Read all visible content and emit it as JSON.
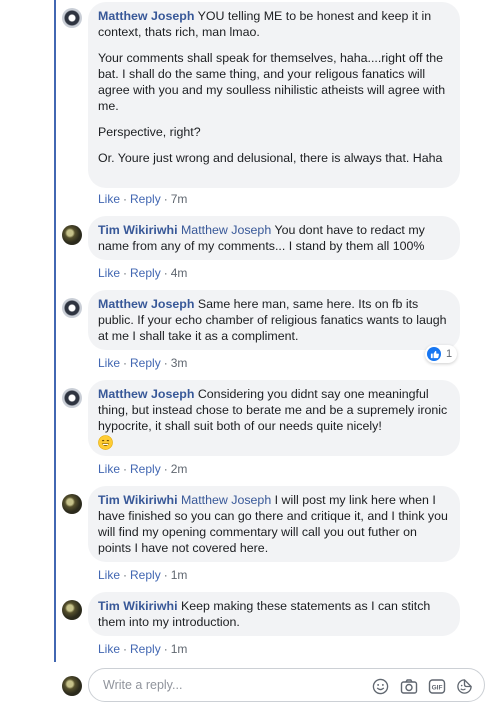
{
  "comments": [
    {
      "author": "Matthew Joseph",
      "mention": "",
      "paragraphs": [
        "YOU telling ME to be honest and keep it in context, thats rich, man lmao.",
        "Your comments shall speak for themselves, haha....right off the bat. I shall do the same thing, and your religous fanatics will agree with you and my soulless nihilistic atheists will agree with me.",
        "Perspective, right?",
        "Or. Youre just wrong and delusional, there is always that. Haha"
      ],
      "like_label": "Like",
      "reply_label": "Reply",
      "time": "7m"
    },
    {
      "author": "Tim Wikiriwhi",
      "mention": "Matthew Joseph",
      "text": "You dont have to redact my name from any of my comments... I stand by them all 100%",
      "like_label": "Like",
      "reply_label": "Reply",
      "time": "4m"
    },
    {
      "author": "Matthew Joseph",
      "mention": "",
      "text": "Same here man, same here. Its on fb its public. If your echo chamber of religious fanatics wants to laugh at me I shall take it as a compliment.",
      "like_label": "Like",
      "reply_label": "Reply",
      "time": "3m",
      "reaction_count": "1"
    },
    {
      "author": "Matthew Joseph",
      "mention": "",
      "text": "Considering you didnt say one meaningful thing, but instead chose to berate me and be a supremely ironic hypocrite, it shall suit both of our needs quite nicely!",
      "emoji": "grinning-face",
      "like_label": "Like",
      "reply_label": "Reply",
      "time": "2m"
    },
    {
      "author": "Tim Wikiriwhi",
      "mention": "Matthew Joseph",
      "text": "I will post my link here when I have finished so you can go there and critique it, and I think you will find my opening commentary will call you out futher on points I have not covered here.",
      "like_label": "Like",
      "reply_label": "Reply",
      "time": "1m"
    },
    {
      "author": "Tim Wikiriwhi",
      "mention": "",
      "text": "Keep making these statements as I can stitch them into my introduction.",
      "like_label": "Like",
      "reply_label": "Reply",
      "time": "1m"
    }
  ],
  "reply_box": {
    "placeholder": "Write a reply...",
    "tools": [
      "emoji-icon",
      "camera-icon",
      "gif-icon",
      "sticker-icon"
    ]
  },
  "colors": {
    "link": "#385898",
    "action": "#4267b2",
    "bubble": "#f2f3f5",
    "thread": "#4267b2",
    "like": "#1877f2"
  }
}
